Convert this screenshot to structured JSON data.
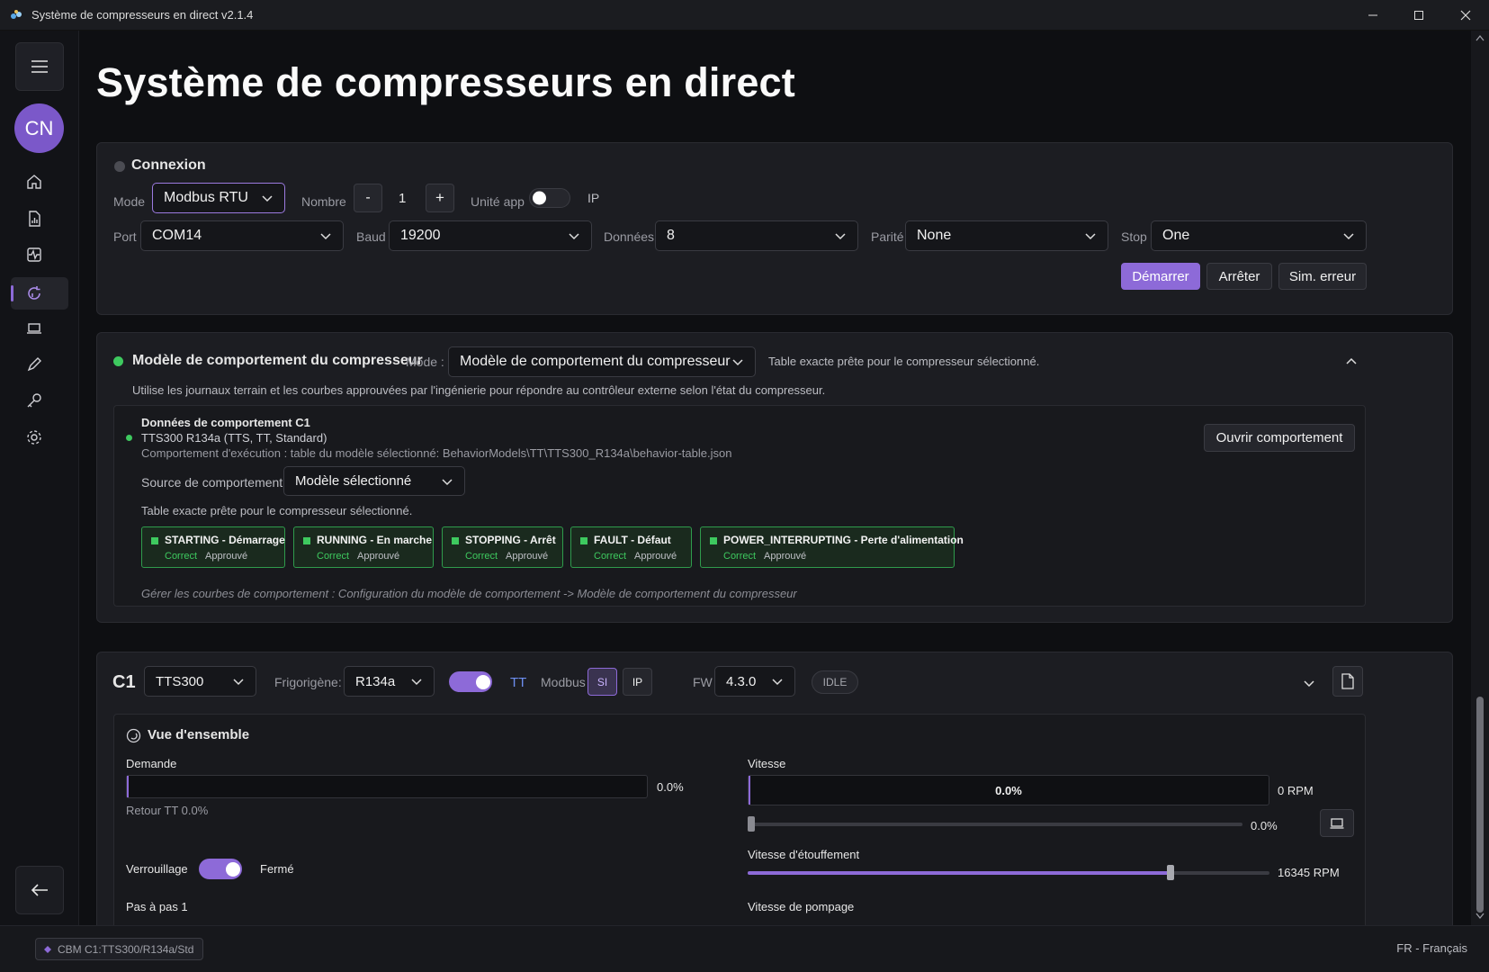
{
  "window": {
    "title": "Système de compresseurs en direct v2.1.4"
  },
  "sidebar": {
    "avatar_initials": "CN",
    "accent": "#8d6ad8",
    "items": [
      {
        "name": "home-icon"
      },
      {
        "name": "report-icon"
      },
      {
        "name": "activity-icon"
      },
      {
        "name": "live-compressor-icon"
      },
      {
        "name": "laptop-icon"
      },
      {
        "name": "pen-icon"
      },
      {
        "name": "key-icon"
      },
      {
        "name": "settings-icon"
      }
    ]
  },
  "page": {
    "title": "Système de compresseurs en direct"
  },
  "connexion": {
    "title": "Connexion",
    "mode_label": "Mode",
    "mode_value": "Modbus RTU",
    "nombre_label": "Nombre",
    "minus": "-",
    "nombre_value": "1",
    "plus": "+",
    "unite_label": "Unité app",
    "ip_label": "IP",
    "port_label": "Port",
    "port_value": "COM14",
    "baud_label": "Baud",
    "baud_value": "19200",
    "donnees_label": "Données",
    "donnees_value": "8",
    "parite_label": "Parité",
    "parite_value": "None",
    "stop_label": "Stop",
    "stop_value": "One",
    "start_btn": "Démarrer",
    "stop_btn": "Arrêter",
    "sim_btn": "Sim. erreur"
  },
  "behavior": {
    "title": "Modèle de comportement du compresseur",
    "mode_label": "Mode :",
    "mode_value": "Modèle de comportement du compresseur",
    "ready_text": "Table exacte prête pour le compresseur sélectionné.",
    "description": "Utilise les journaux terrain et les courbes approuvées par l'ingénierie pour répondre au contrôleur externe selon l'état du compresseur.",
    "data_title": "Données de comportement C1",
    "model_line": "TTS300 R134a (TTS, TT, Standard)",
    "exec_line": "Comportement d'exécution : table du modèle sélectionné: BehaviorModels\\TT\\TTS300_R134a\\behavior-table.json",
    "open_btn": "Ouvrir comportement",
    "source_label": "Source de comportement :",
    "source_value": "Modèle sélectionné",
    "ready_text2": "Table exacte prête pour le compresseur sélectionné.",
    "states": [
      {
        "name": "STARTING - Démarrage",
        "ok": "Correct",
        "ap": "Approuvé"
      },
      {
        "name": "RUNNING - En marche",
        "ok": "Correct",
        "ap": "Approuvé"
      },
      {
        "name": "STOPPING - Arrêt",
        "ok": "Correct",
        "ap": "Approuvé"
      },
      {
        "name": "FAULT - Défaut",
        "ok": "Correct",
        "ap": "Approuvé"
      },
      {
        "name": "POWER_INTERRUPTING - Perte d'alimentation",
        "ok": "Correct",
        "ap": "Approuvé"
      }
    ],
    "manage_text": "Gérer les courbes de comportement : Configuration du modèle de comportement -> Modèle de comportement du compresseur"
  },
  "c1": {
    "id": "C1",
    "model": "TTS300",
    "refrig_label": "Frigorigène:",
    "refrig_value": "R134a",
    "tt_label": "TT",
    "modbus_label": "Modbus",
    "si_label": "SI",
    "ip_label": "IP",
    "fw_label": "FW",
    "fw_value": "4.3.0",
    "state_badge": "IDLE",
    "overview_title": "Vue d'ensemble",
    "demande_label": "Demande",
    "demande_value": "0.0%",
    "retour_label": "Retour TT 0.0%",
    "vitesse_label": "Vitesse",
    "vitesse_bar_text": "0.0%",
    "vitesse_rpm": "0 RPM",
    "vitesse_slider_value": "0.0%",
    "etouff_label": "Vitesse d'étouffement",
    "etouff_value": "16345 RPM",
    "etouff_fraction": 0.81,
    "verrou_label": "Verrouillage",
    "verrou_state": "Fermé",
    "pas_label": "Pas à pas 1",
    "pompage_label": "Vitesse de pompage"
  },
  "statusbar": {
    "cbm": "CBM C1:TTS300/R134a/Std",
    "lang": "FR - Français"
  }
}
